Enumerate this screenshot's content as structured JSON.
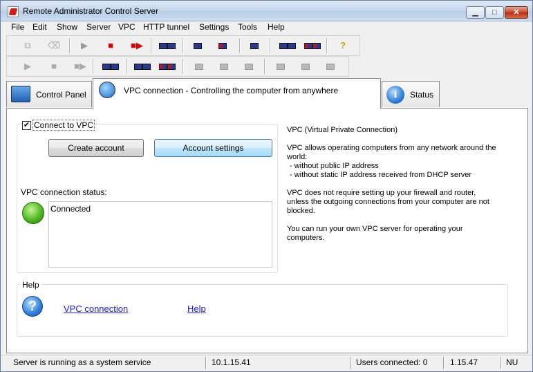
{
  "window": {
    "title": "Remote Administrator Control Server",
    "min_glyph": "▁",
    "max_glyph": "□",
    "close_glyph": "✕"
  },
  "menu": [
    "File",
    "Edit",
    "Show",
    "Server",
    "VPC",
    "HTTP tunnel",
    "Settings",
    "Tools",
    "Help"
  ],
  "tabs": {
    "control_panel": "Control Panel",
    "vpc": "VPC connection - Controlling the computer from anywhere",
    "status": "Status"
  },
  "vpc": {
    "connect_checkbox_label": "Connect to VPC",
    "connect_checked": true,
    "check_glyph": "✔",
    "create_account_button": "Create account",
    "account_settings_button": "Account settings",
    "status_label": "VPC connection status:",
    "status_value": "Connected",
    "status_color": "#4fb821"
  },
  "info": {
    "title": "VPC (Virtual Private Connection)",
    "p1_line1": "VPC allows operating computers from any network around the",
    "p1_line2": "world:",
    "bullet1": "- without public IP address",
    "bullet2": "- without static IP address received from DHCP server",
    "p2_line1": "VPC does not require setting up your firewall and router,",
    "p2_line2": "unless the outgoing connections from your computer are not",
    "p2_line3": "blocked.",
    "p3_line1": "You can run your own VPC server for operating your",
    "p3_line2": "computers."
  },
  "help": {
    "group_label": "Help",
    "icon_glyph": "?",
    "link_vpc": "VPC connection",
    "link_help": "Help"
  },
  "toolbar": {
    "copy_glyph": "⧉",
    "erase_glyph": "⌫",
    "play_glyph": "▶",
    "stop_glyph": "■",
    "play_stop_glyph": "■▶",
    "help_glyph": "?"
  },
  "statusbar": {
    "message": "Server is running as a system service",
    "ip": "10.1.15.41",
    "users": "Users connected: 0",
    "version": "1.15.47",
    "extra": "NU"
  },
  "colors": {
    "link": "#1a1ad8",
    "stop_red": "#e01010",
    "accent_blue": "#2f7ed8"
  }
}
